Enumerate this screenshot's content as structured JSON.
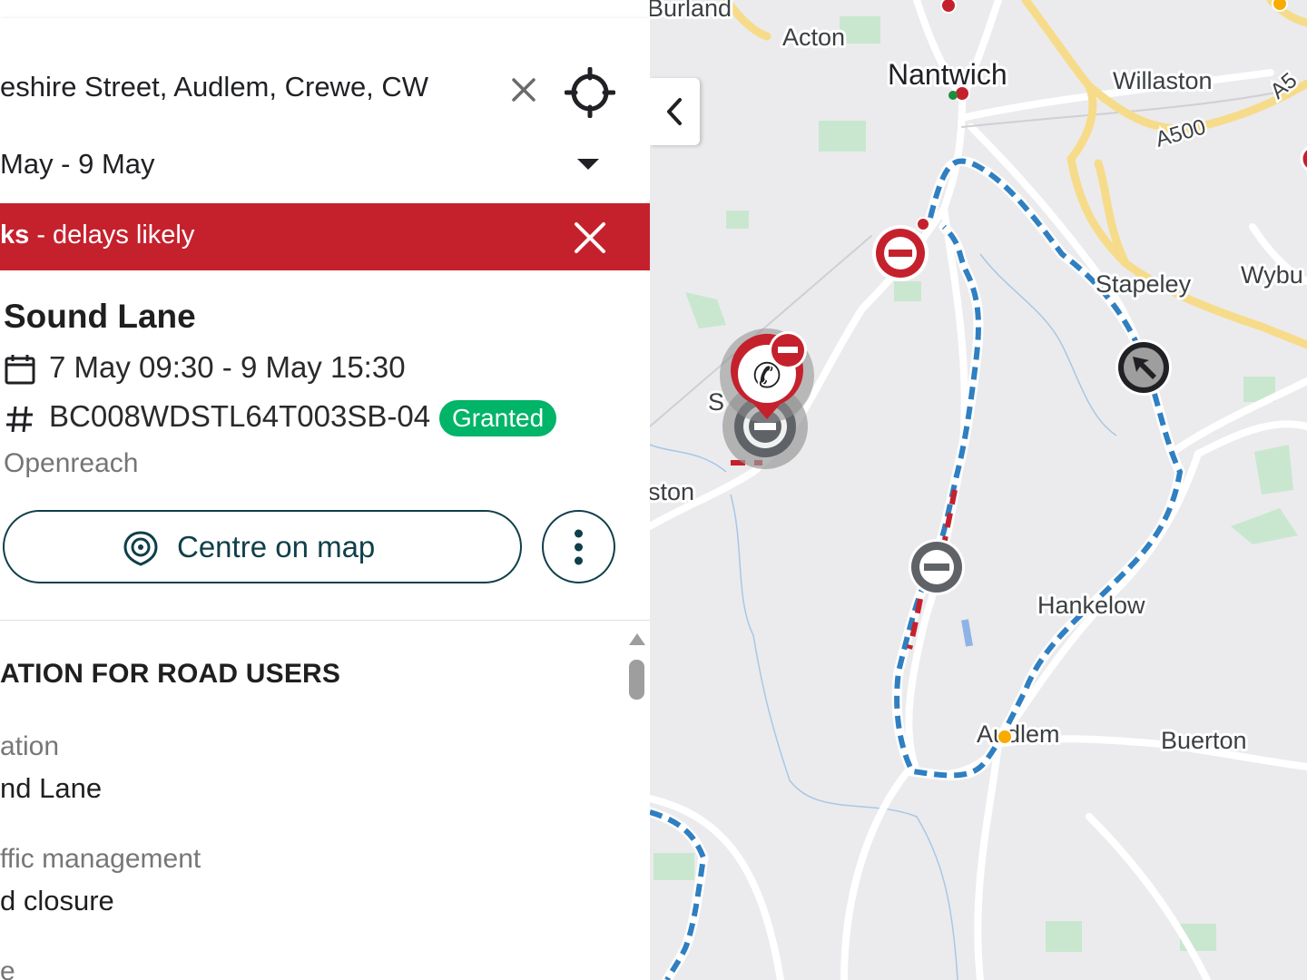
{
  "search": {
    "address": "eshire Street, Audlem, Crewe, CW",
    "date_range": "May - 9 May"
  },
  "alert": {
    "bold_text": "ks",
    "text": " - delays likely",
    "color": "#c5212d"
  },
  "works": {
    "title": "Sound Lane",
    "dates": "7 May 09:30 - 9 May 15:30",
    "reference": "BC008WDSTL64T003SB-04",
    "status": "Granted",
    "status_color": "#00b468",
    "promoter": "Openreach",
    "centre_label": "Centre on map"
  },
  "info": {
    "heading": "ATION FOR ROAD USERS",
    "location_label": "ation",
    "location_value": "nd Lane",
    "traffic_label": "ffic management",
    "traffic_value": "d closure",
    "type_label": "e"
  },
  "map": {
    "places": {
      "burland": "Burland",
      "acton": "Acton",
      "nantwich": "Nantwich",
      "willaston": "Willaston",
      "stapeley": "Stapeley",
      "wybunbury": "Wybu",
      "hankelow": "Hankelow",
      "audlem": "Audlem",
      "buerton": "Buerton",
      "ston": "ston",
      "sound_partial": "S"
    },
    "roads": {
      "a500": "A500",
      "a5_partial": "A5"
    },
    "diversion_color": "#2f7fc1",
    "closure_color": "#c5212d"
  },
  "icons": {
    "clear": "close-icon",
    "locate": "crosshair-icon",
    "calendar": "calendar-icon",
    "hash": "hash-icon",
    "target": "target-icon",
    "more": "more-vertical-icon",
    "collapse": "chevron-left-icon"
  }
}
